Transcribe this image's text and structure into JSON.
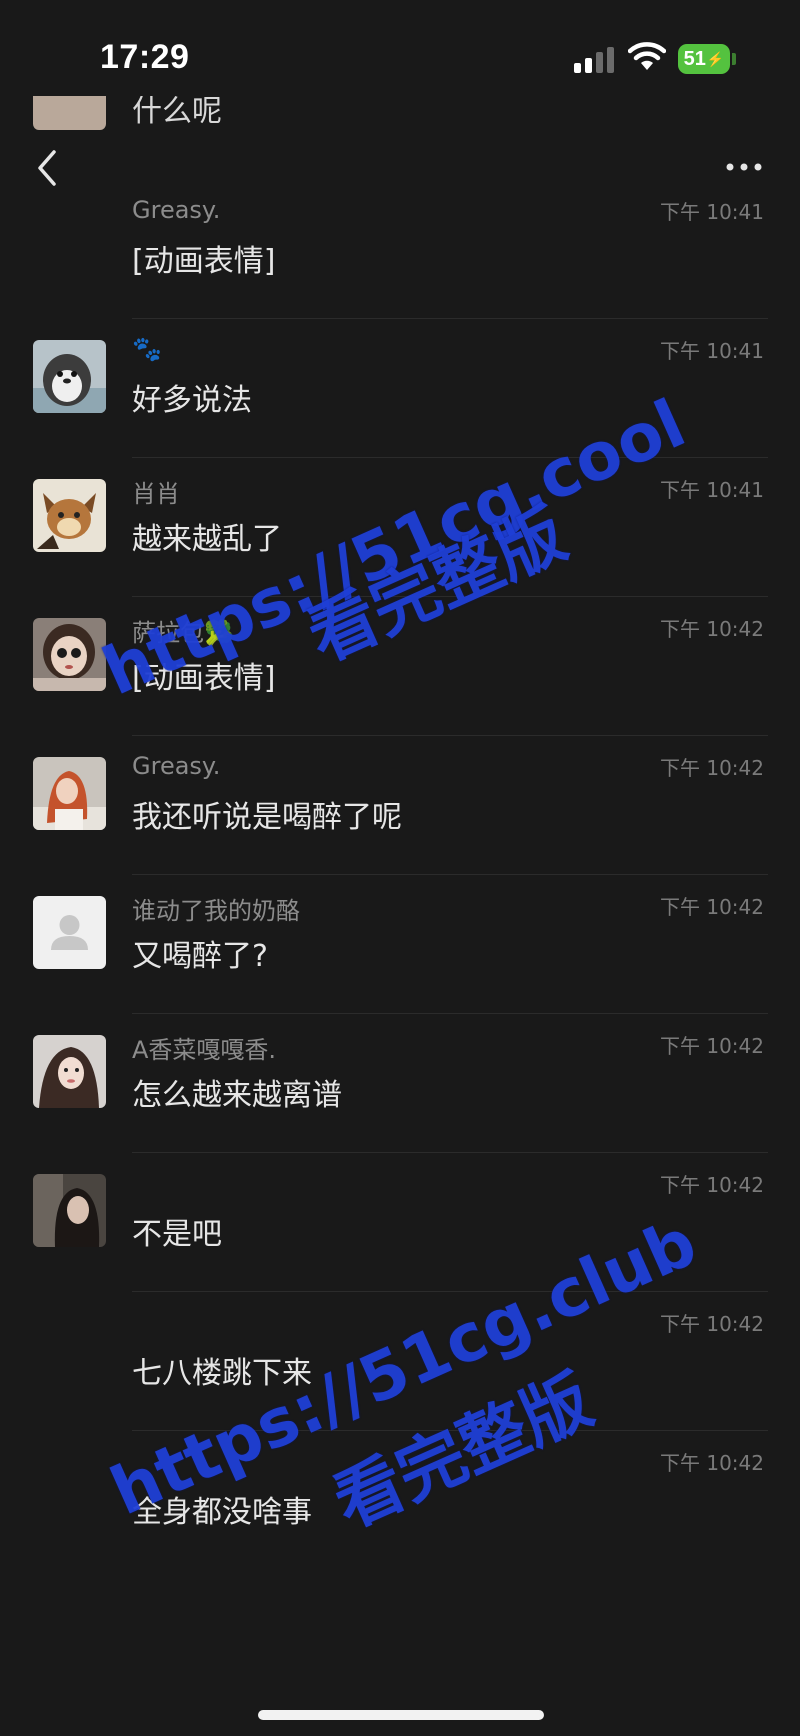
{
  "status_bar": {
    "time": "17:29",
    "battery": "51"
  },
  "partial_message": {
    "text": "什么呢"
  },
  "nav": {
    "back_icon": "chevron-left-icon",
    "more_icon": "more-dots-icon"
  },
  "messages": [
    {
      "sender": "Greasy.",
      "text": "[动画表情]",
      "time": "下午 10:41",
      "avatar": "none"
    },
    {
      "sender": "🐾",
      "text": "好多说法",
      "time": "下午 10:41",
      "avatar": "penguin"
    },
    {
      "sender": "肖肖",
      "text": "越来越乱了",
      "time": "下午 10:41",
      "avatar": "cartoon"
    },
    {
      "sender": "萨拉包🥦",
      "text": "[动画表情]",
      "time": "下午 10:42",
      "avatar": "doll"
    },
    {
      "sender": "Greasy.",
      "text": "我还听说是喝醉了呢",
      "time": "下午 10:42",
      "avatar": "girl-red"
    },
    {
      "sender": "谁动了我的奶酪",
      "text": "又喝醉了?",
      "time": "下午 10:42",
      "avatar": "default"
    },
    {
      "sender": "A香菜嘎嘎香.",
      "text": "怎么越来越离谱",
      "time": "下午 10:42",
      "avatar": "selfie"
    },
    {
      "sender": "",
      "text": "不是吧",
      "time": "下午 10:42",
      "avatar": "dark-hair"
    },
    {
      "sender": "",
      "text": "七八楼跳下来",
      "time": "下午 10:42",
      "avatar": "none"
    },
    {
      "sender": "",
      "text": "全身都没啥事",
      "time": "下午 10:42",
      "avatar": "none"
    }
  ],
  "watermarks": {
    "top_url": "https://51cg.cool",
    "top_sub": "看完整版",
    "bottom_url": "https://51cg.club",
    "bottom_sub": "看完整版",
    "color": "#1f3fd6"
  }
}
